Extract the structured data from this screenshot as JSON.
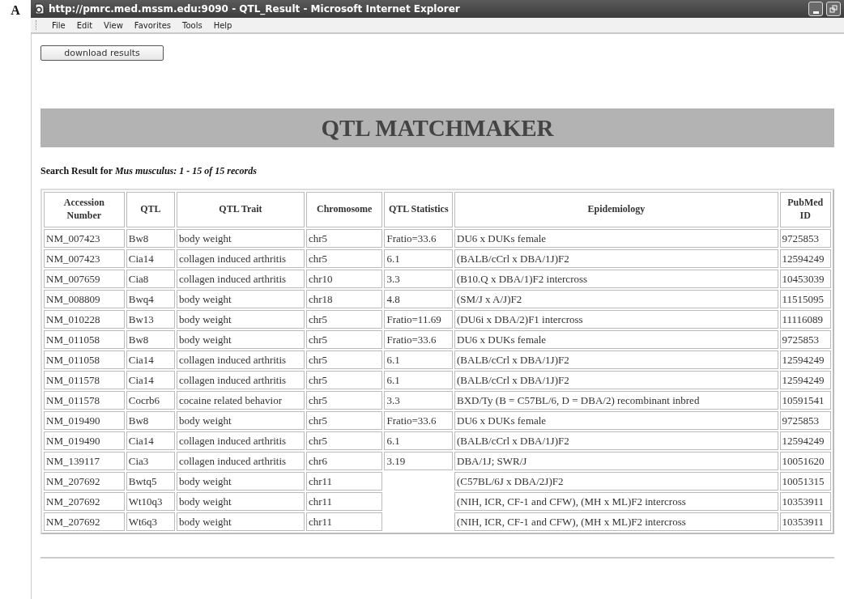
{
  "panel_label": "A",
  "window": {
    "title": "http://pmrc.med.mssm.edu:9090 - QTL_Result - Microsoft Internet Explorer",
    "menu": [
      "File",
      "Edit",
      "View",
      "Favorites",
      "Tools",
      "Help"
    ]
  },
  "download_button": "download results",
  "banner": "QTL MATCHMAKER",
  "result_summary": "Search Result for *Mus musculus: 1 - 15 of 15 records*",
  "table": {
    "columns": [
      "Accession Number",
      "QTL",
      "QTL Trait",
      "Chromosome",
      "QTL Statistics",
      "Epidemiology",
      "PubMed ID"
    ],
    "rows": [
      [
        "NM_007423",
        "Bw8",
        "body weight",
        "chr5",
        "Fratio=33.6",
        "DU6 x DUKs female",
        "9725853"
      ],
      [
        "NM_007423",
        "Cia14",
        "collagen induced arthritis",
        "chr5",
        "6.1",
        "(BALB/cCrl x DBA/1J)F2",
        "12594249"
      ],
      [
        "NM_007659",
        "Cia8",
        "collagen induced arthritis",
        "chr10",
        "3.3",
        "(B10.Q x DBA/1)F2 intercross",
        "10453039"
      ],
      [
        "NM_008809",
        "Bwq4",
        "body weight",
        "chr18",
        "4.8",
        " (SM/J x A/J)F2",
        "11515095"
      ],
      [
        "NM_010228",
        "Bw13",
        "body weight",
        "chr5",
        "Fratio=11.69",
        "(DU6i x DBA/2)F1 intercross",
        "11116089"
      ],
      [
        "NM_011058",
        "Bw8",
        "body weight",
        "chr5",
        "Fratio=33.6",
        "DU6 x DUKs female",
        "9725853"
      ],
      [
        "NM_011058",
        "Cia14",
        "collagen induced arthritis",
        "chr5",
        "6.1",
        "(BALB/cCrl x DBA/1J)F2",
        "12594249"
      ],
      [
        "NM_011578",
        "Cia14",
        "collagen induced arthritis",
        "chr5",
        "6.1",
        "(BALB/cCrl x DBA/1J)F2",
        "12594249"
      ],
      [
        "NM_011578",
        "Cocrb6",
        "cocaine related behavior",
        "chr5",
        "3.3",
        "BXD/Ty (B = C57BL/6, D = DBA/2) recombinant inbred",
        "10591541"
      ],
      [
        "NM_019490",
        "Bw8",
        "body weight",
        "chr5",
        "Fratio=33.6",
        "DU6 x DUKs female",
        "9725853"
      ],
      [
        "NM_019490",
        "Cia14",
        "collagen induced arthritis",
        "chr5",
        "6.1",
        "(BALB/cCrl x DBA/1J)F2",
        "12594249"
      ],
      [
        "NM_139117",
        "Cia3",
        "collagen induced arthritis",
        "chr6",
        "3.19",
        "DBA/1J; SWR/J",
        "10051620"
      ],
      [
        "NM_207692",
        "Bwtq5",
        "body weight",
        "chr11",
        null,
        "(C57BL/6J x DBA/2J)F2",
        "10051315"
      ],
      [
        "NM_207692",
        "Wt10q3",
        "body weight",
        "chr11",
        null,
        "(NIH, ICR, CF-1 and CFW), (MH x ML)F2 intercross",
        "10353911"
      ],
      [
        "NM_207692",
        "Wt6q3",
        "body weight",
        "chr11",
        null,
        "(NIH, ICR, CF-1 and CFW), (MH x ML)F2 intercross",
        "10353911"
      ]
    ]
  }
}
